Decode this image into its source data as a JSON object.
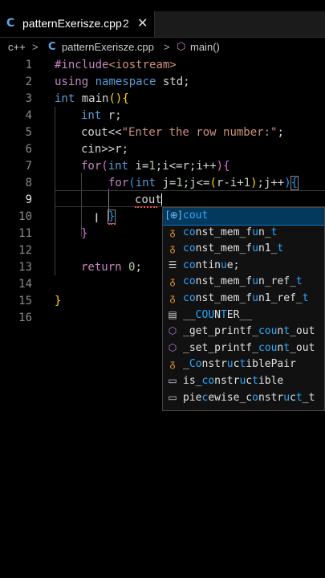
{
  "tab": {
    "icon": "C",
    "filename": "patternExerisze.cpp",
    "problems": "2",
    "close": "✕"
  },
  "breadcrumb": {
    "lang": "c++",
    "sep1": ">",
    "file_icon": "C",
    "file": "patternExerisze.cpp",
    "sep2": ">",
    "fn_icon": "⬡",
    "fn": "main()"
  },
  "code": {
    "line_numbers": [
      "1",
      "2",
      "3",
      "4",
      "5",
      "6",
      "7",
      "8",
      "9",
      "10",
      "11",
      "12",
      "13",
      "14",
      "15",
      "16"
    ],
    "l1": {
      "a": "#include",
      "b": "<iostream>"
    },
    "l2": {
      "a": "using",
      "b": " namespace",
      "c": " std;"
    },
    "l3": {
      "a": "int",
      "b": " main",
      "c": "()",
      "d": "{"
    },
    "l4": {
      "a": "int",
      "b": " r;"
    },
    "l5": {
      "a": "cout<<",
      "b": "\"Enter the row number:\"",
      "c": ";"
    },
    "l6": {
      "a": "cin>>r;"
    },
    "l7": {
      "a": "for",
      "b": "(",
      "c": "int",
      "d": " i=",
      "e": "1",
      "f": ";i<=r;i++",
      "g": ")",
      "h": "{"
    },
    "l8": {
      "a": "for",
      "b": "(",
      "c": "int",
      "d": " j=",
      "e": "1",
      "f": ";j<=",
      "g": "(",
      "h": "r-i+",
      "i": "1",
      "j": ")",
      "k": ";j++",
      "l": ")",
      "m": "{"
    },
    "l9": {
      "a": "cout"
    },
    "l10": {
      "a": "}"
    },
    "l11": {
      "a": "}"
    },
    "l13": {
      "a": "return",
      "b": " 0",
      "c": ";"
    },
    "l15": {
      "a": "}"
    }
  },
  "suggestions": [
    {
      "icon": "snippet-var-icon",
      "glyph": "[⊕]",
      "pre": "",
      "match": "cout",
      "post": "",
      "kind": "ic-var"
    },
    {
      "icon": "function-icon",
      "glyph": "ᵹ",
      "pre": "",
      "match": "co",
      "post": "nst_mem_f",
      "rest": "un",
      "tail": "_t",
      "kind": "ic-fn"
    },
    {
      "icon": "function-icon",
      "glyph": "ᵹ",
      "pre": "",
      "match": "co",
      "post": "nst_mem_f",
      "rest": "un",
      "tail": "1_t",
      "kind": "ic-fn"
    },
    {
      "icon": "keyword-icon",
      "glyph": "☰",
      "pre": "",
      "match": "co",
      "post": "n",
      "rest": "t",
      "tail": "inue;",
      "kind": "ic-kw"
    },
    {
      "icon": "function-icon",
      "glyph": "ᵹ",
      "pre": "",
      "match": "co",
      "post": "nst_mem_f",
      "rest": "un",
      "tail": "_ref_t",
      "kind": "ic-fn"
    },
    {
      "icon": "function-icon",
      "glyph": "ᵹ",
      "pre": "",
      "match": "co",
      "post": "nst_mem_f",
      "rest": "un",
      "tail": "1_ref_t",
      "kind": "ic-fn"
    },
    {
      "icon": "constant-icon",
      "glyph": "▤",
      "pre": "__",
      "match": "CO",
      "post": "",
      "rest": "UNT",
      "tail": "ER__",
      "kind": "ic-field"
    },
    {
      "icon": "method-icon",
      "glyph": "⬡",
      "pre": "_get_printf_",
      "match": "cou",
      "post": "n",
      "rest": "t",
      "tail": "_out",
      "kind": "ic-method"
    },
    {
      "icon": "method-icon",
      "glyph": "⬡",
      "pre": "_set_printf_",
      "match": "cou",
      "post": "n",
      "rest": "t",
      "tail": "_out",
      "kind": "ic-method"
    },
    {
      "icon": "function-icon",
      "glyph": "ᵹ",
      "pre": "_",
      "match": "Co",
      "post": "nstr",
      "rest": "u",
      "tail": "ctiblePair",
      "kind": "ic-fn"
    },
    {
      "icon": "struct-icon",
      "glyph": "▭",
      "pre": "is_",
      "match": "co",
      "post": "nstr",
      "rest": "u",
      "tail": "ctible",
      "kind": "ic-struct"
    },
    {
      "icon": "struct-icon",
      "glyph": "▭",
      "pre": "piece",
      "match": "",
      "post": "wise_",
      "rest": "co",
      "tail": "nstruct_t",
      "kind": "ic-struct"
    }
  ],
  "suggestion_labels": [
    "cout",
    "const_mem_fun_t",
    "const_mem_fun1_t",
    "continue;",
    "const_mem_fun_ref_t",
    "const_mem_fun1_ref_t",
    "__COUNTER__",
    "_get_printf_count_out",
    "_set_printf_count_out",
    "_ConstructiblePair",
    "is_constructible",
    "piecewise_construct_t"
  ]
}
